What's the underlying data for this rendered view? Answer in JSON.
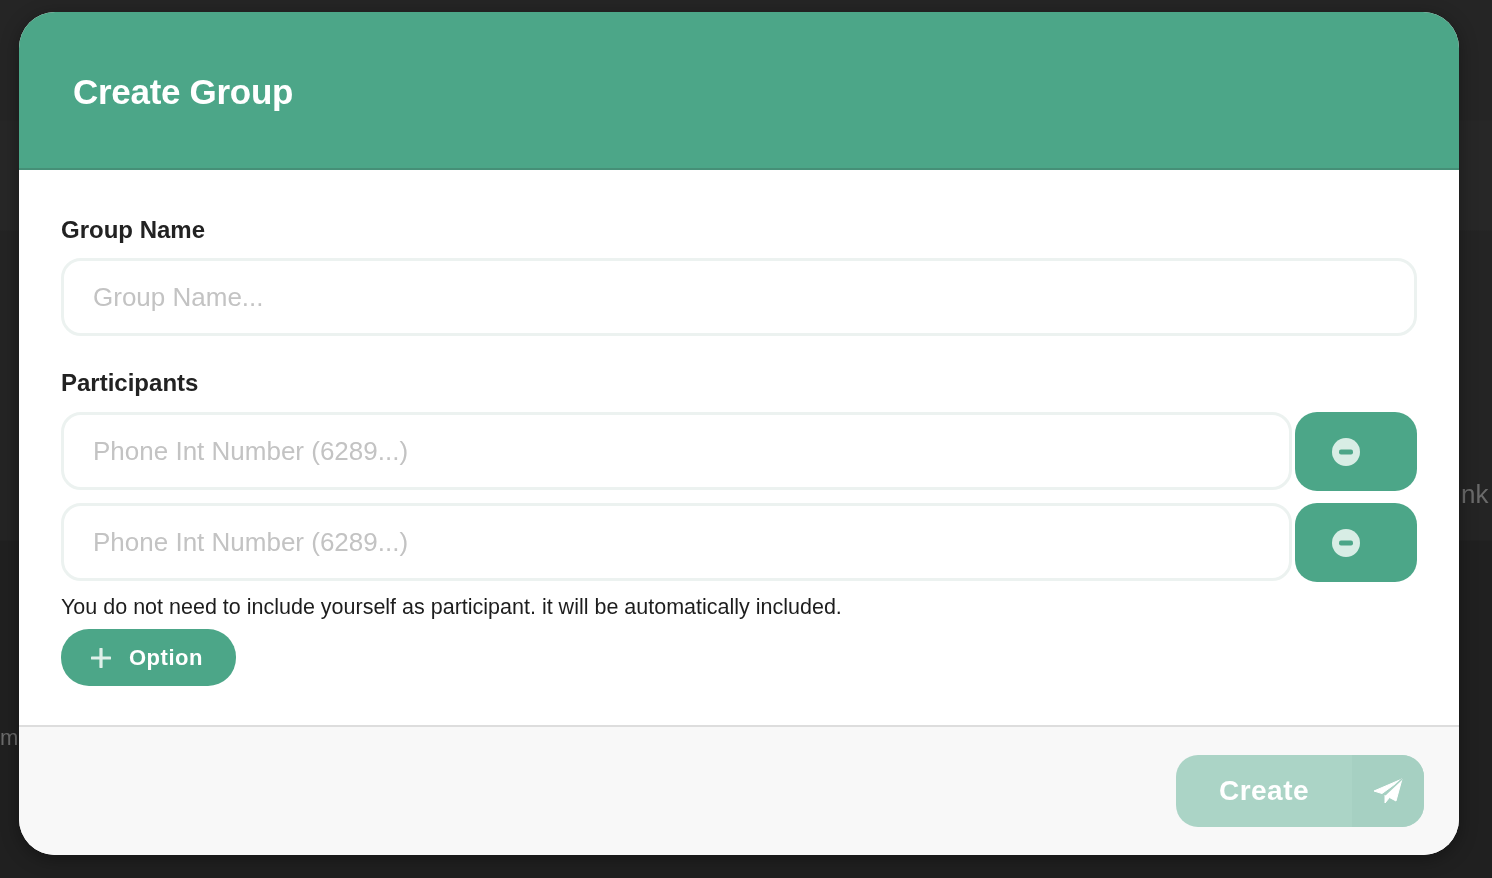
{
  "background_text": [
    "nk",
    "m"
  ],
  "dialog": {
    "title": "Create Group",
    "group_name": {
      "label": "Group Name",
      "placeholder": "Group Name..."
    },
    "participants": {
      "label": "Participants",
      "rows": [
        {
          "placeholder": "Phone Int Number (6289...)"
        },
        {
          "placeholder": "Phone Int Number (6289...)"
        }
      ],
      "note": "You do not need to include yourself as participant. it will be automatically included.",
      "add_button": {
        "label": "Option"
      }
    },
    "create_button": {
      "label": "Create",
      "disabled": true
    }
  }
}
